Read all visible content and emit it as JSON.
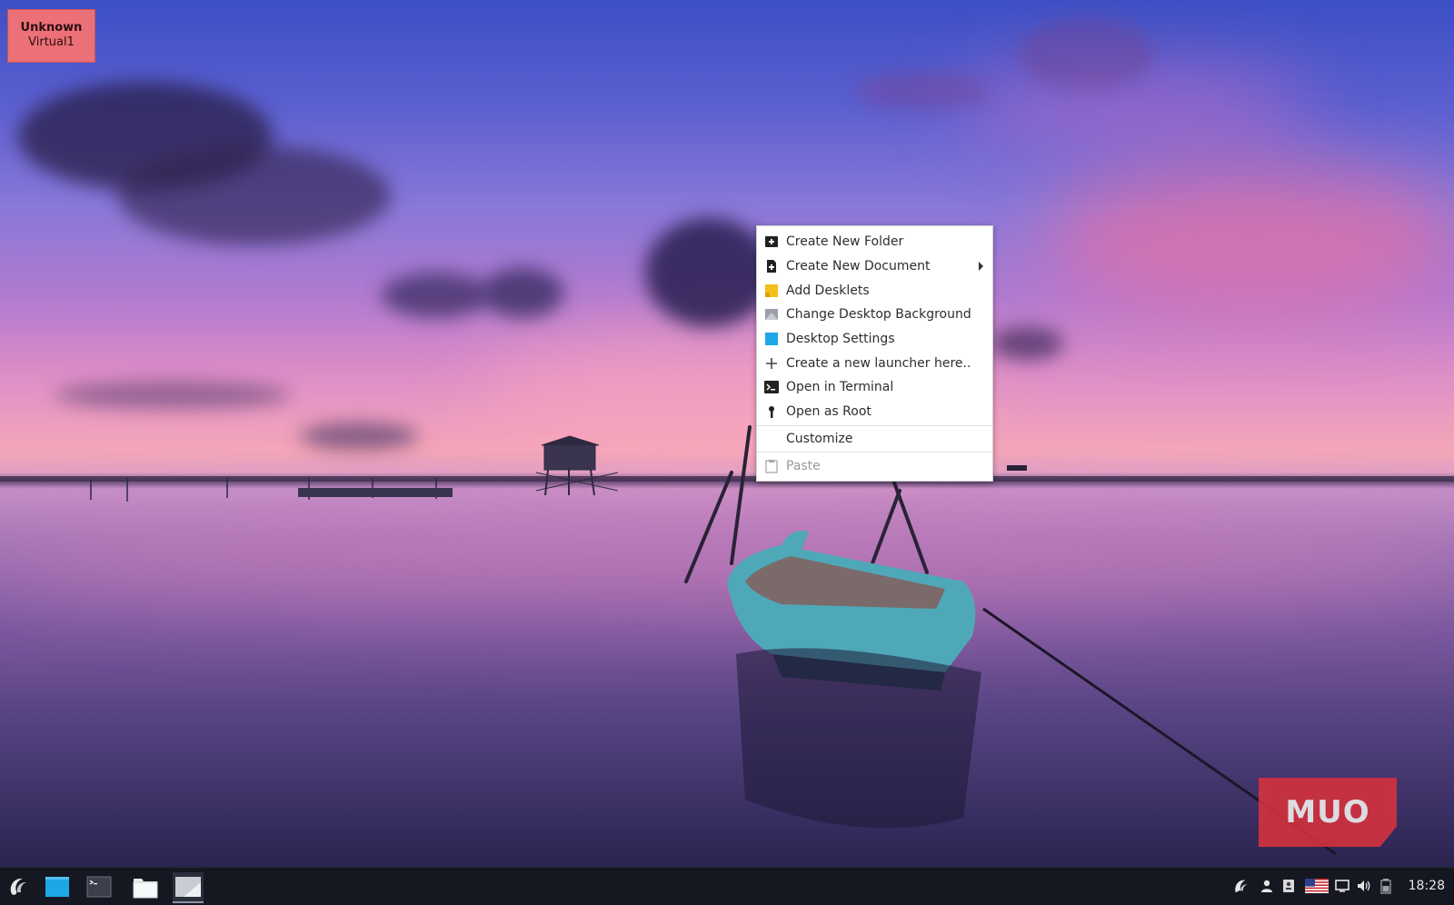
{
  "workspace": {
    "host": "Unknown",
    "name": "Virtual1",
    "color": "#ec7077"
  },
  "context_menu": {
    "items": [
      {
        "label": "Create New Folder",
        "icon": "new-folder-icon",
        "enabled": true,
        "submenu": false
      },
      {
        "label": "Create New Document",
        "icon": "new-document-icon",
        "enabled": true,
        "submenu": true
      },
      {
        "label": "Add Desklets",
        "icon": "desklets-icon",
        "enabled": true,
        "submenu": false
      },
      {
        "label": "Change Desktop Background",
        "icon": "background-icon",
        "enabled": true,
        "submenu": false
      },
      {
        "label": "Desktop Settings",
        "icon": "desktop-settings-icon",
        "enabled": true,
        "submenu": false
      },
      {
        "label": "Create a new launcher here..",
        "icon": "plus-icon",
        "enabled": true,
        "submenu": false
      },
      {
        "label": "Open in Terminal",
        "icon": "terminal-icon",
        "enabled": true,
        "submenu": false
      },
      {
        "label": "Open as Root",
        "icon": "root-icon",
        "enabled": true,
        "submenu": false
      },
      {
        "label": "Customize",
        "icon": "",
        "enabled": true,
        "submenu": false
      },
      {
        "label": "Paste",
        "icon": "paste-icon",
        "enabled": false,
        "submenu": false
      }
    ]
  },
  "watermark": {
    "text": "MUO",
    "color": "#d8323c"
  },
  "taskbar": {
    "launchers": [
      "menu-logo-icon",
      "desktop-icon",
      "terminal-icon",
      "file-manager-icon",
      "text-editor-icon"
    ],
    "tray": [
      "network-icon",
      "user-icon",
      "contacts-icon",
      "us-flag-icon",
      "display-icon",
      "volume-icon",
      "battery-icon"
    ],
    "clock": "18:28"
  },
  "colors": {
    "menu_bg": "#ffffff",
    "taskbar_bg": "#151821",
    "accent_blue": "#1ea7e8"
  }
}
